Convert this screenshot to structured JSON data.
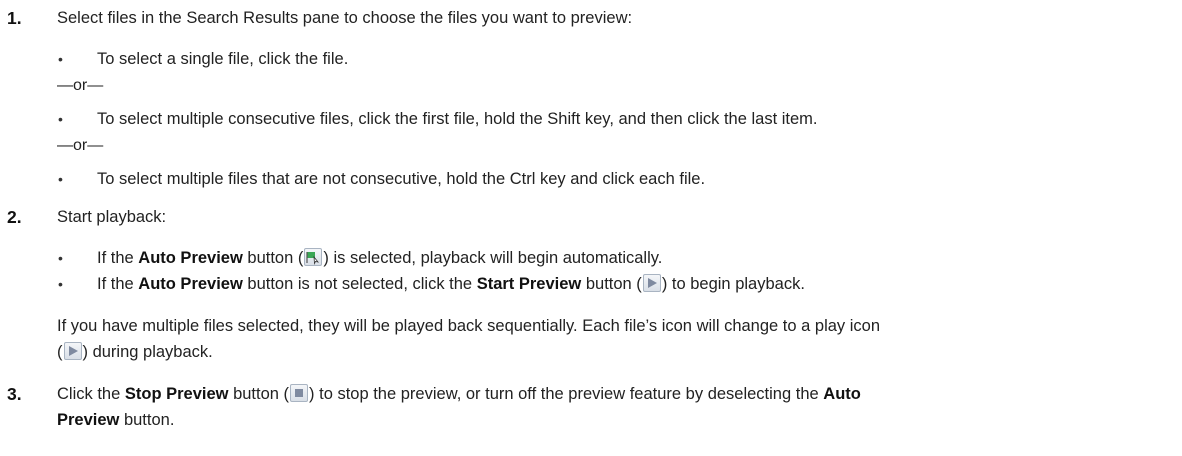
{
  "steps": [
    {
      "number": "1.",
      "text": "Select files in the Search Results pane to choose the files you want to preview:",
      "bullets": [
        "To select a single file, click the file.",
        "To select multiple consecutive files, click the first file, hold the Shift key, and then click the last item.",
        "To select multiple files that are not consecutive, hold the Ctrl key and click each file."
      ],
      "separator": "—or—"
    },
    {
      "number": "2.",
      "text": "Start playback:",
      "bullet1": {
        "pre": "If the ",
        "bold": "Auto Preview",
        "mid": " button (",
        "post": ") is selected, playback will begin automatically."
      },
      "bullet2": {
        "pre": "If the ",
        "bold1": "Auto Preview",
        "mid1": " button is not selected, click the ",
        "bold2": "Start Preview",
        "mid2": " button (",
        "post": ") to begin playback."
      },
      "note_line1": "If you have multiple files selected, they will be played back sequentially. Each file’s icon will change to a play icon",
      "note_line2_pre": "(",
      "note_line2_post": ") during playback."
    },
    {
      "number": "3.",
      "pre": "Click the ",
      "bold1": "Stop Preview",
      "mid": " button (",
      "post": ") to stop the preview, or turn off the preview feature by deselecting the ",
      "bold2": "Auto",
      "line2_bold": "Preview",
      "line2_post": " button."
    }
  ],
  "icons": {
    "auto_preview": "auto-preview-icon",
    "start_preview": "play-icon",
    "stop_preview": "stop-icon"
  }
}
